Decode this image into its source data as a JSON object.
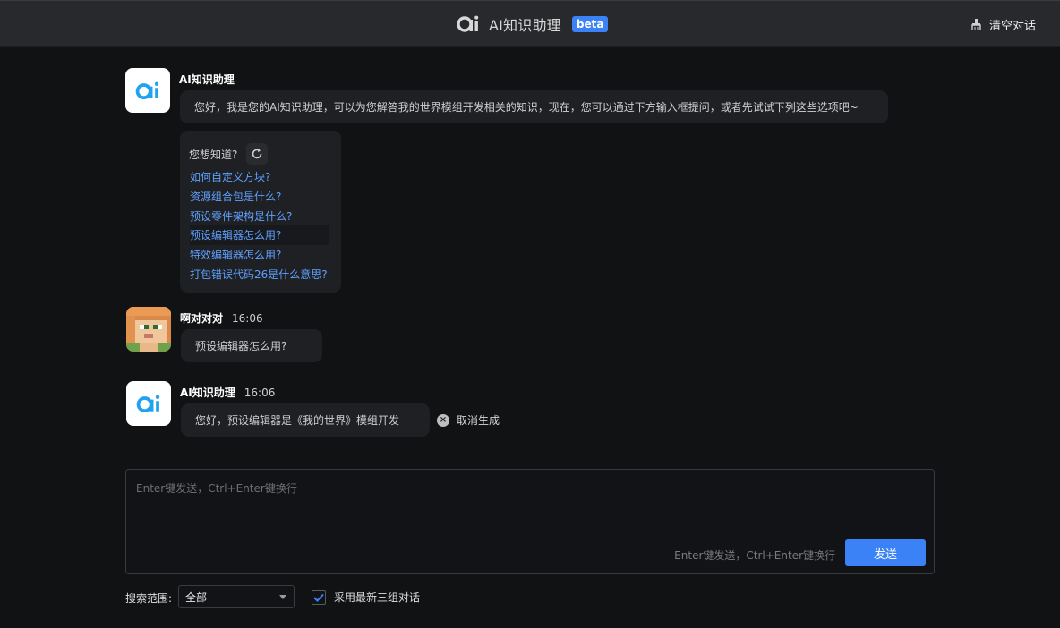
{
  "header": {
    "title": "AI知识助理",
    "badge": "beta",
    "clear_label": "清空对话"
  },
  "messages": [
    {
      "sender": "AI知识助理",
      "time": "",
      "text": "您好，我是您的AI知识助理，可以为您解答我的世界模组开发相关的知识，现在，您可以通过下方输入框提问，或者先试试下列这些选项吧~"
    },
    {
      "sender": "啊对对对",
      "time": "16:06",
      "text": "预设编辑器怎么用?"
    },
    {
      "sender": "AI知识助理",
      "time": "16:06",
      "text": "您好，预设编辑器是《我的世界》模组开发"
    }
  ],
  "suggestions": {
    "heading": "您想知道?",
    "items": [
      "如何自定义方块?",
      "资源组合包是什么?",
      "预设零件架构是什么?",
      "预设编辑器怎么用?",
      "特效编辑器怎么用?",
      "打包错误代码26是什么意思?"
    ]
  },
  "cancel_label": "取消生成",
  "input": {
    "placeholder": "Enter键发送，Ctrl+Enter键换行",
    "hint": "Enter键发送，Ctrl+Enter键换行",
    "send_label": "发送"
  },
  "footer": {
    "scope_label": "搜索范围:",
    "scope_value": "全部",
    "recent_label": "采用最新三组对话",
    "recent_checked": true
  },
  "colors": {
    "accent": "#3b82f6",
    "link": "#5ea1ff",
    "ai_logo": "#1fa3f0"
  }
}
